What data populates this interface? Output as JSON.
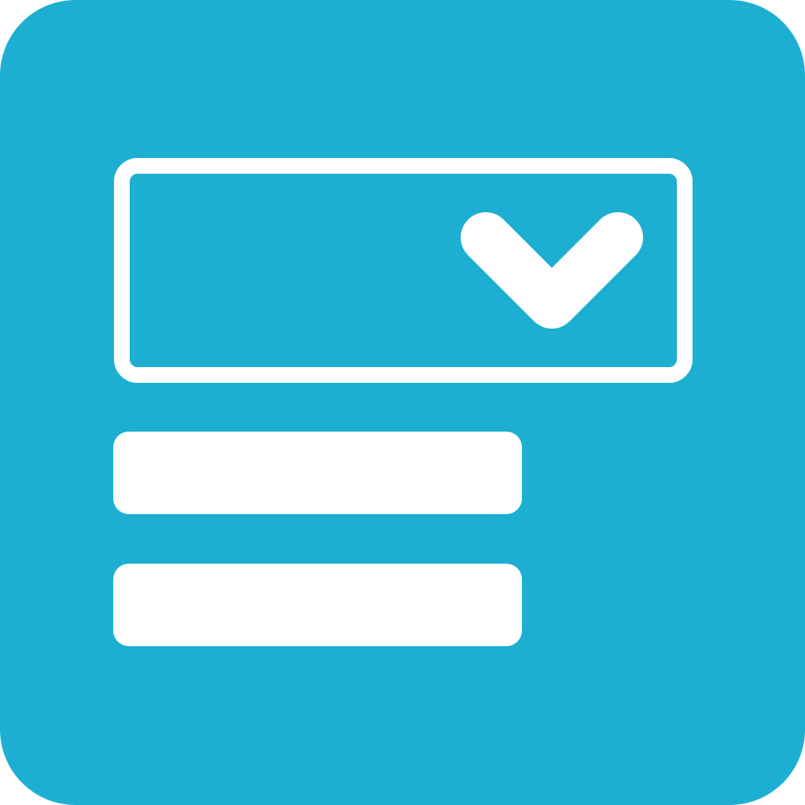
{
  "icon": {
    "name": "dropdown-select-icon",
    "background_color": "#1DAFD2",
    "foreground_color": "#FFFFFF",
    "parts": {
      "select_box": "dropdown-box",
      "indicator": "chevron-down-icon",
      "options": [
        "option-bar",
        "option-bar"
      ]
    }
  }
}
